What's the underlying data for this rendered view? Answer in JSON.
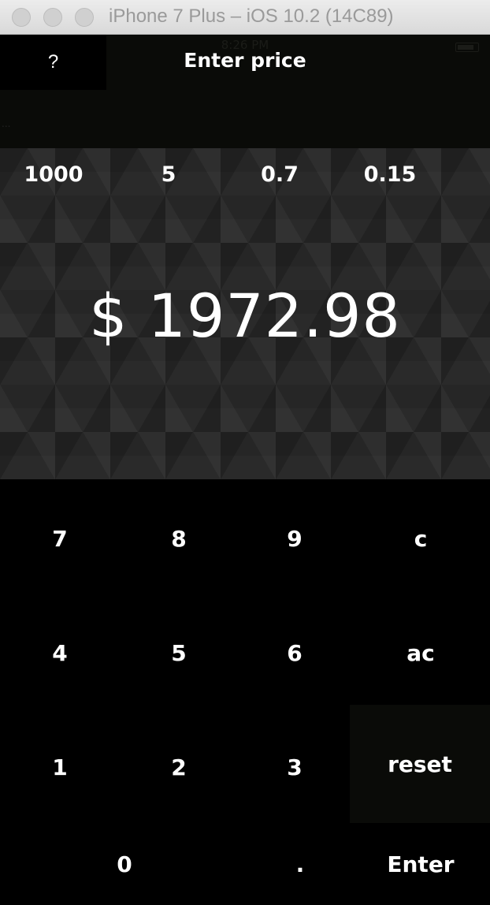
{
  "window": {
    "title": "iPhone 7 Plus – iOS 10.2 (14C89)"
  },
  "status_bar": {
    "time": "8:26 PM"
  },
  "header": {
    "help_label": "?",
    "title": "Enter price",
    "dots": "..."
  },
  "presets": [
    "1000",
    "5",
    "0.7",
    "0.15"
  ],
  "display": {
    "amount": "$ 1972.98"
  },
  "keypad": {
    "k7": "7",
    "k8": "8",
    "k9": "9",
    "clear": "c",
    "k4": "4",
    "k5": "5",
    "k6": "6",
    "all_clear": "ac",
    "k1": "1",
    "k2": "2",
    "k3": "3",
    "reset": "reset",
    "k0": "0",
    "dot": ".",
    "enter": "Enter"
  },
  "colors": {
    "header_bg": "#0a0b08",
    "display_bg": "#262626",
    "keypad_bg": "#000000",
    "text": "#ffffff"
  }
}
